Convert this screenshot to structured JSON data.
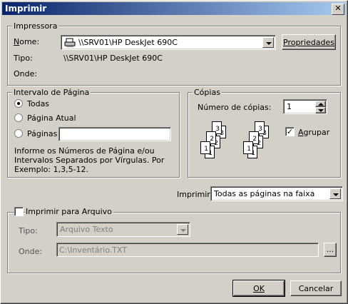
{
  "window": {
    "title": "Imprimir",
    "close_glyph": "✕"
  },
  "printer": {
    "group_label": "Impressora",
    "name_label": "Nome:",
    "name_value": "\\\\SRV01\\HP DeskJet 690C",
    "properties_button": "Propriedades",
    "type_label": "Tipo:",
    "type_value": "\\\\SRV01\\HP DeskJet 690C",
    "where_label": "Onde:"
  },
  "range": {
    "group_label": "Intervalo de Página",
    "all_label": "Todas",
    "current_label": "Página Atual",
    "pages_label": "Páginas",
    "pages_value": "",
    "selected": "all",
    "help_text_1": "Informe os Números de Página e/ou",
    "help_text_2": "Intervalos Separados por Vírgulas. Por",
    "help_text_3": "Exemplo: 1,3,5-12."
  },
  "copies": {
    "group_label": "Cópias",
    "count_label": "Número de cópias:",
    "count_value": "1",
    "collate_label": "Agrupar",
    "collate_checked": true,
    "page_numbers": [
      "1",
      "2",
      "3"
    ]
  },
  "print_what": {
    "label": "Imprimir",
    "value": "Todas as páginas na faixa"
  },
  "print_to_file": {
    "label": "Imprimir para Arquivo",
    "checked": false,
    "type_label": "Tipo:",
    "type_value": "Arquivo Texto",
    "where_label": "Onde:",
    "where_value": "C:\\Inventário.TXT",
    "browse_label": "..."
  },
  "buttons": {
    "ok": "OK",
    "cancel": "Cancelar"
  },
  "icons": {
    "printer": "printer-icon"
  }
}
